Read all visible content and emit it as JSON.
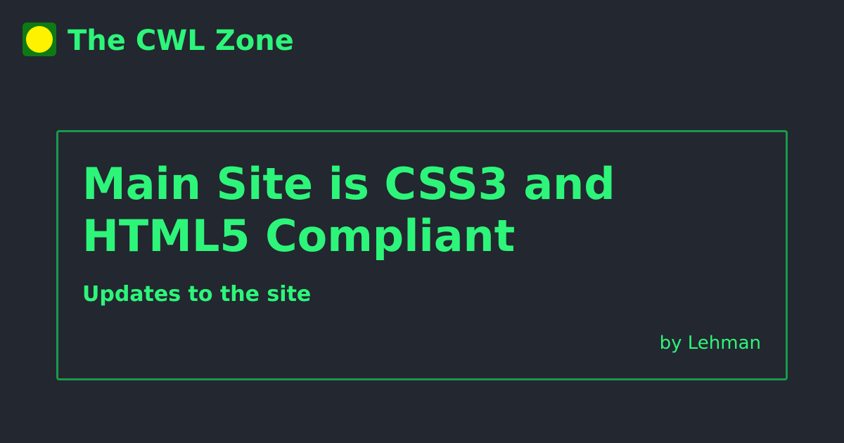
{
  "header": {
    "site_name": "The CWL Zone",
    "logo": "green-square-yellow-dot-logo"
  },
  "card": {
    "title": "Main Site is CSS3 and HTML5 Compliant",
    "subtitle": "Updates to the site",
    "author": "by Lehman"
  },
  "colors": {
    "background": "#23272f",
    "accent_text": "#2df57a",
    "card_border": "#199a4c",
    "logo_bg": "#0f7a13",
    "logo_dot": "#fff200"
  }
}
